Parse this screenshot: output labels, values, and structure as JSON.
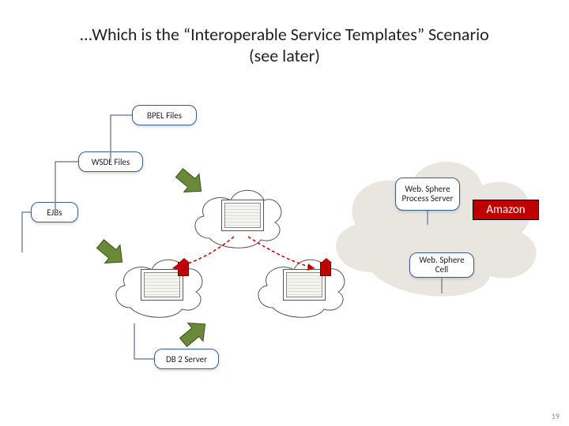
{
  "title": {
    "line1": "…Which is the “Interoperable Service Templates” Scenario",
    "line2": "(see later)"
  },
  "boxes": {
    "bpel": "BPEL Files",
    "wsdl": "WSDL Files",
    "ejbs": "EJBs",
    "wps": "Web. Sphere Process Server",
    "cell": "Web. Sphere Cell",
    "db2": "DB 2 Server",
    "amazon": "Amazon"
  },
  "icons": {
    "cloud_big": "cloud",
    "cloud_small": "cloud",
    "server": "server",
    "arrow": "green-arrow"
  },
  "page": "19"
}
